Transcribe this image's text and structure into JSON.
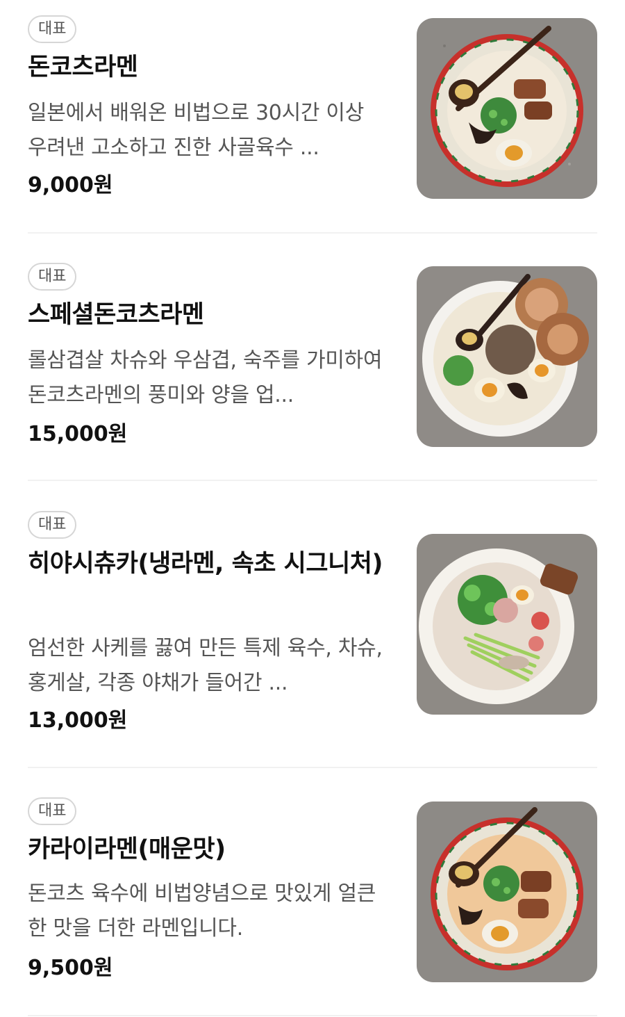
{
  "menu": {
    "items": [
      {
        "badge": "대표",
        "name": "돈코츠라멘",
        "description": "일본에서 배워온 비법으로 30시간 이상 우려낸 고소하고 진한 사골육수 ...",
        "price": "9,000원",
        "image_icon": "tonkotsu-ramen-bowl-icon"
      },
      {
        "badge": "대표",
        "name": "스페셜돈코츠라멘",
        "description": "롤삼겹살 차슈와 우삼겹, 숙주를 가미하여 돈코츠라멘의 풍미와 양을 업...",
        "price": "15,000원",
        "image_icon": "special-ramen-bowl-icon"
      },
      {
        "badge": "대표",
        "name": "히야시츄카(냉라멘, 속초 시그니처)",
        "description": "엄선한 사케를 끓여 만든 특제 육수, 차슈, 홍게살, 각종 야채가 들어간 ...",
        "price": "13,000원",
        "image_icon": "cold-ramen-bowl-icon"
      },
      {
        "badge": "대표",
        "name": "카라이라멘(매운맛)",
        "description": "돈코츠 육수에 비법양념으로 맛있게 얼큰한 맛을 더한 라멘입니다.",
        "price": "9,500원",
        "image_icon": "spicy-ramen-bowl-icon"
      }
    ]
  },
  "colors": {
    "text_primary": "#111111",
    "text_secondary": "#555555",
    "badge_border": "#d6d6d6",
    "divider": "#f1f1f1"
  }
}
